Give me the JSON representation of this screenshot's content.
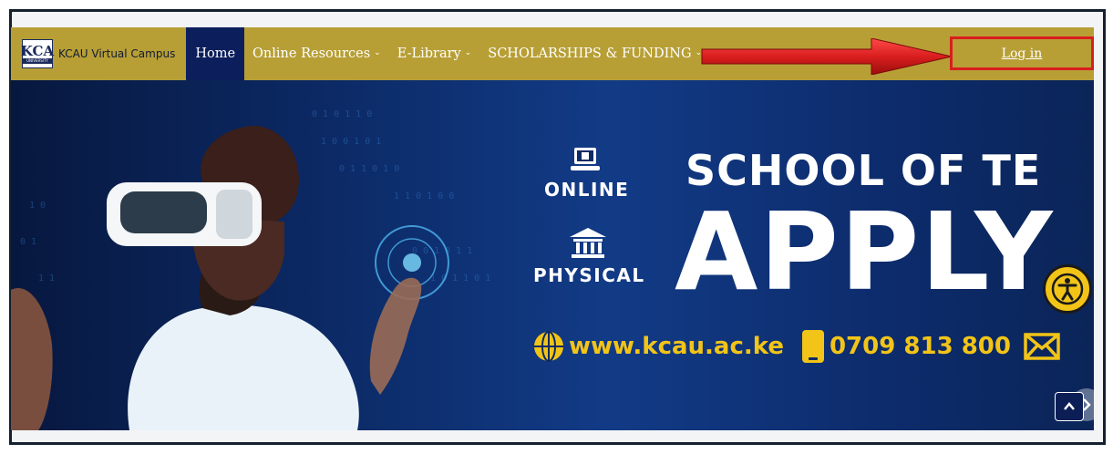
{
  "navbar": {
    "brand_text": "KCAU Virtual Campus",
    "logo_letters": "KCA",
    "logo_sub": "UNIVERSITY",
    "items": [
      {
        "label": "Home",
        "active": true,
        "dropdown": false
      },
      {
        "label": "Online Resources",
        "active": false,
        "dropdown": true
      },
      {
        "label": "E-Library",
        "active": false,
        "dropdown": true
      },
      {
        "label": "SCHOLARSHIPS & FUNDING",
        "active": false,
        "dropdown": true
      }
    ],
    "login_label": "Log in"
  },
  "hero": {
    "mode_online": "ONLINE",
    "mode_physical": "PHYSICAL",
    "headline": "SCHOOL OF TE",
    "cta": "APPLY",
    "website": "www.kcau.ac.ke",
    "phone": "0709 813 800"
  },
  "icons": {
    "laptop": "laptop-icon",
    "institution": "institution-icon",
    "globe": "globe-icon",
    "phone": "phone-icon",
    "mail": "mail-icon",
    "accessibility": "accessibility-icon",
    "next": "chevron-right-icon",
    "scroll_top": "chevron-up-icon"
  },
  "colors": {
    "navbar_bg": "#b79f36",
    "active_bg": "#0c1f5c",
    "login_highlight": "#d91e1e",
    "annotation_arrow": "#d91e1e",
    "hero_accent": "#f2c418",
    "hero_bg": "#0c2a66"
  }
}
